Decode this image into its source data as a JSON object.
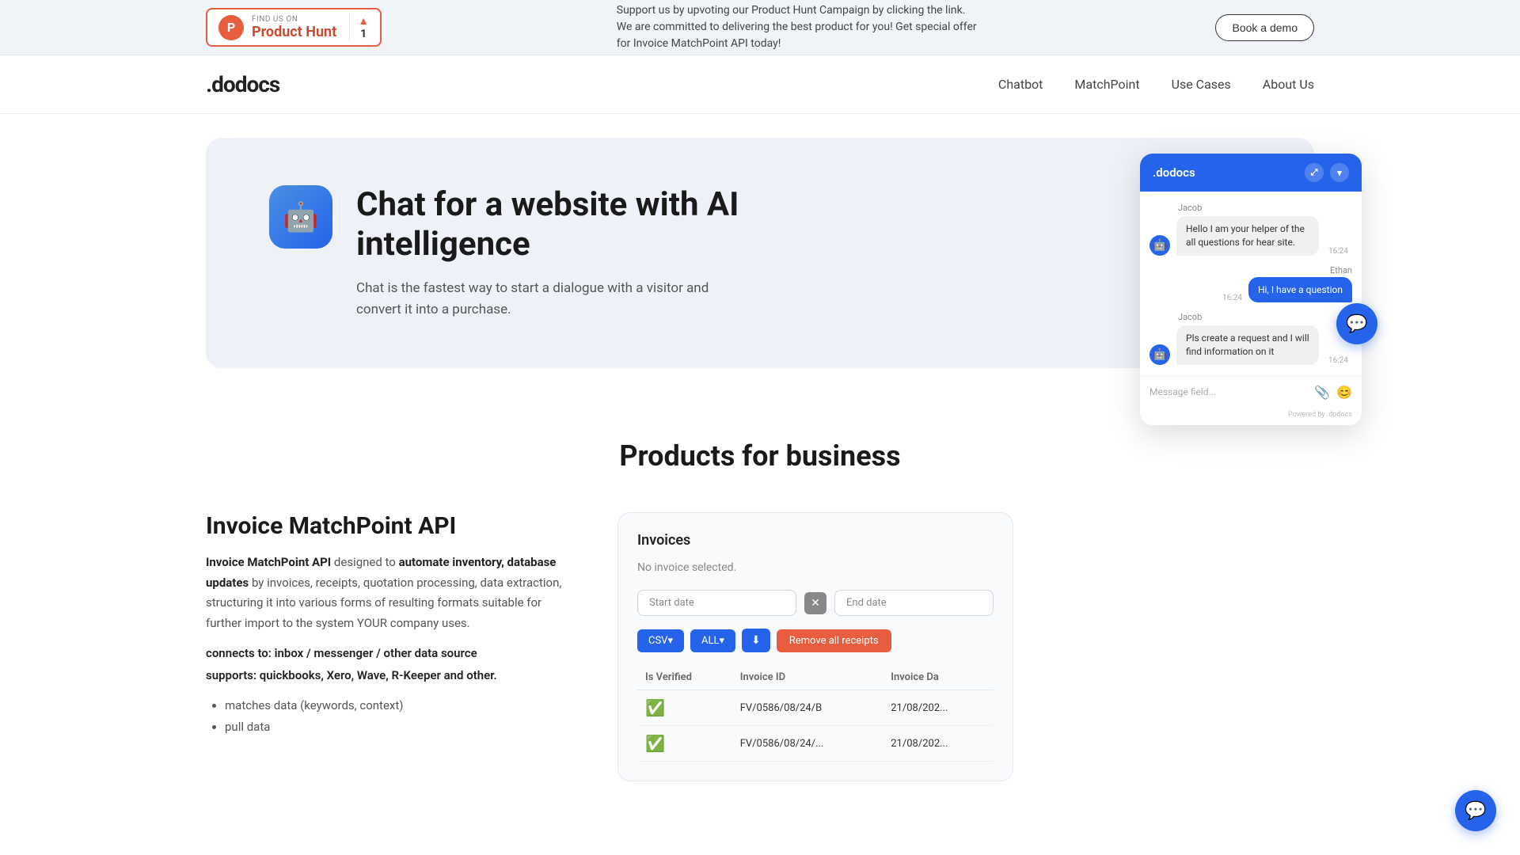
{
  "banner": {
    "find_us_on": "FIND US ON",
    "product_hunt": "Product Hunt",
    "vote_count": "1",
    "support_text": "Support us by upvoting our Product Hunt Campaign by clicking the link. We are committed to delivering the best product for you! Get special offer for Invoice MatchPoint API today!",
    "book_demo": "Book a demo"
  },
  "nav": {
    "logo": ".dodocs",
    "links": [
      {
        "label": "Chatbot",
        "id": "chatbot"
      },
      {
        "label": "MatchPoint",
        "id": "matchpoint"
      },
      {
        "label": "Use Cases",
        "id": "use-cases"
      },
      {
        "label": "About Us",
        "id": "about-us"
      }
    ]
  },
  "hero": {
    "icon": "🤖",
    "title": "Chat for a website with AI intelligence",
    "subtitle": "Chat is the fastest way to start a dialogue with a visitor and convert it into a purchase."
  },
  "chat_widget": {
    "title": ".dodocs",
    "expand_icon": "⤢",
    "collapse_icon": "▾",
    "messages": [
      {
        "sender": "Jacob",
        "text": "Hello I am your helper of the all questions for hear site.",
        "time": "16:24",
        "type": "bot"
      },
      {
        "sender": "Ethan",
        "text": "Hi, I have a question",
        "time": "16:24",
        "type": "user"
      },
      {
        "sender": "Jacob",
        "text": "Pls create a request and I will find information on it",
        "time": "16:24",
        "type": "bot"
      }
    ],
    "input_placeholder": "Message field...",
    "powered_by": "Powered by .dodocs"
  },
  "products": {
    "section_title": "Products for business",
    "invoice": {
      "title": "Invoice MatchPoint API",
      "desc_part1": "Invoice MatchPoint API",
      "desc_part2": "designed to",
      "desc_bold": "automate inventory, database updates",
      "desc_part3": "by invoices, receipts, quotation processing, data extraction, structuring it into various forms of resulting formats suitable for further import to the system YOUR company uses.",
      "connects_label": "connects to:",
      "connects_value": "inbox / messenger / other data source",
      "supports_label": "supports:",
      "supports_value": "quickbooks, Xero, Wave, R-Keeper and other.",
      "bullets": [
        "matches data (keywords, context)",
        "pull data"
      ]
    },
    "invoice_table": {
      "no_invoice": "No invoice selected.",
      "start_date": "Start date",
      "end_date": "End date",
      "csv_label": "CSV▾",
      "all_label": "ALL▾",
      "download_icon": "⬇",
      "remove_label": "Remove all receipts",
      "columns": [
        "Is Verified",
        "Invoice ID",
        "Invoice Da"
      ],
      "rows": [
        {
          "verified": true,
          "invoice_id": "FV/0586/08/24/B",
          "invoice_date": "21/08/202..."
        },
        {
          "verified": true,
          "invoice_id": "FV/0586/08/24/...",
          "invoice_date": "21/08/202..."
        }
      ]
    }
  }
}
